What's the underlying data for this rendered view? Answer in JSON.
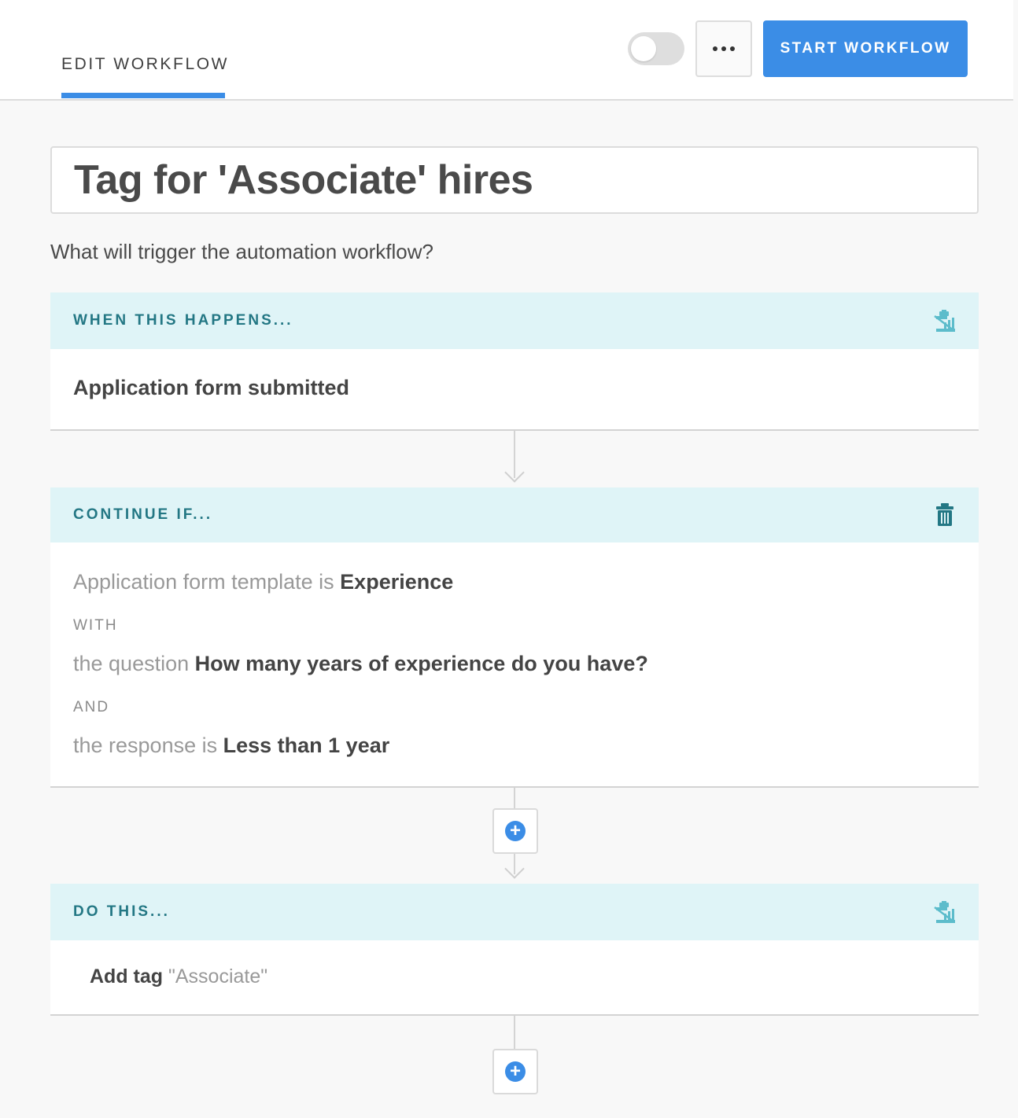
{
  "header": {
    "tab_label": "EDIT WORKFLOW",
    "start_label": "START WORKFLOW",
    "toggle_on": false,
    "accent_color": "#3b8de6"
  },
  "workflow": {
    "title": "Tag for 'Associate' hires",
    "prompt": "What will trigger the automation workflow?"
  },
  "trigger": {
    "heading": "WHEN THIS HAPPENS...",
    "value": "Application form submitted",
    "icon": "no-edit-icon"
  },
  "condition": {
    "heading": "CONTINUE IF...",
    "icon": "trash-icon",
    "template_prefix": "Application form template is",
    "template_value": "Experience",
    "with_label": "WITH",
    "question_prefix": "the question",
    "question_value": "How many years of experience do you have?",
    "and_label": "AND",
    "response_prefix": "the response is",
    "response_value": "Less than 1 year"
  },
  "action": {
    "heading": "DO THIS...",
    "icon": "no-edit-icon",
    "action_label": "Add tag",
    "action_value": "\"Associate\""
  },
  "colors": {
    "section_header_bg": "#dff4f7",
    "section_header_text": "#237784"
  }
}
